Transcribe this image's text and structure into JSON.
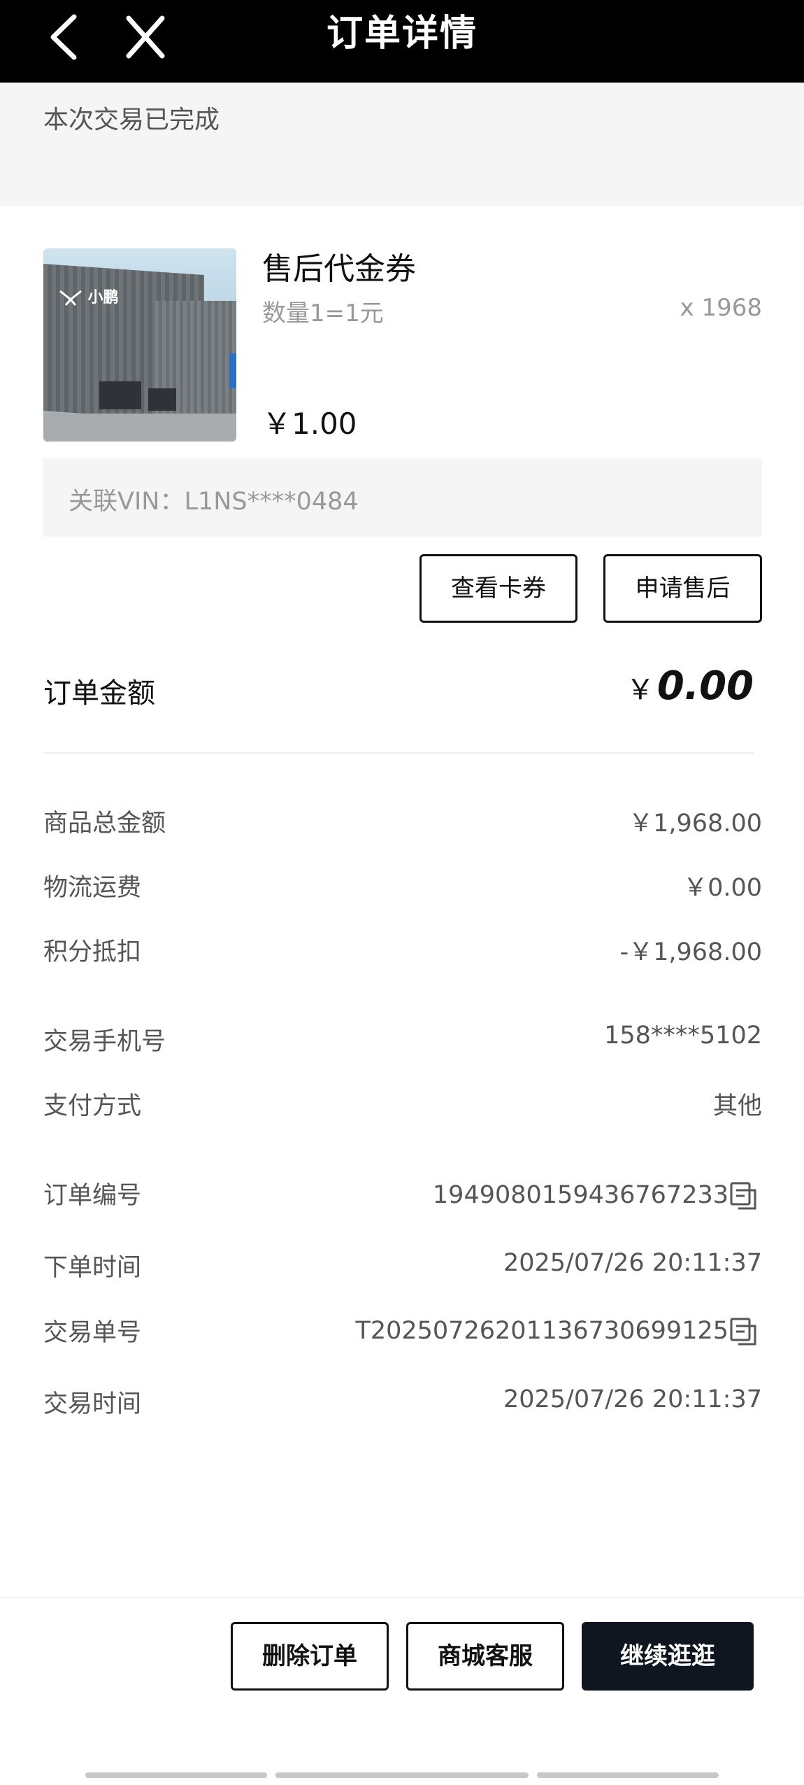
{
  "header": {
    "title": "订单详情"
  },
  "status": {
    "text": "本次交易已完成"
  },
  "product": {
    "name": "售后代金券",
    "spec": "数量1=1元",
    "qty": "x 1968",
    "price": "￥1.00",
    "image_logo_text": "小鹏"
  },
  "vin": {
    "text": "关联VIN：L1NS****0484"
  },
  "actions": {
    "view_coupon": "查看卡券",
    "apply_after_sales": "申请售后"
  },
  "order_amount": {
    "label": "订单金额",
    "currency": "￥",
    "value": "0.00"
  },
  "price_rows": [
    {
      "label": "商品总金额",
      "value": "￥1,968.00"
    },
    {
      "label": "物流运费",
      "value": "￥0.00"
    },
    {
      "label": "积分抵扣",
      "value": "-￥1,968.00"
    }
  ],
  "info_rows": [
    {
      "label": "交易手机号",
      "value": "158****5102"
    },
    {
      "label": "支付方式",
      "value": "其他"
    }
  ],
  "order_rows": [
    {
      "label": "订单编号",
      "value": "1949080159436767233"
    },
    {
      "label": "下单时间",
      "value": "2025/07/26 20:11:37"
    },
    {
      "label": "交易单号",
      "value": "T20250726201136730699125"
    },
    {
      "label": "交易时间",
      "value": "2025/07/26 20:11:37"
    }
  ],
  "bottom_buttons": {
    "delete": "删除订单",
    "service": "商城客服",
    "continue": "继续逛逛"
  },
  "icons": {
    "back": "chevron-left-icon",
    "close": "close-icon",
    "copy": "copy-icon"
  },
  "colors": {
    "header_bg": "#000000",
    "primary_button": "#0f1620"
  }
}
